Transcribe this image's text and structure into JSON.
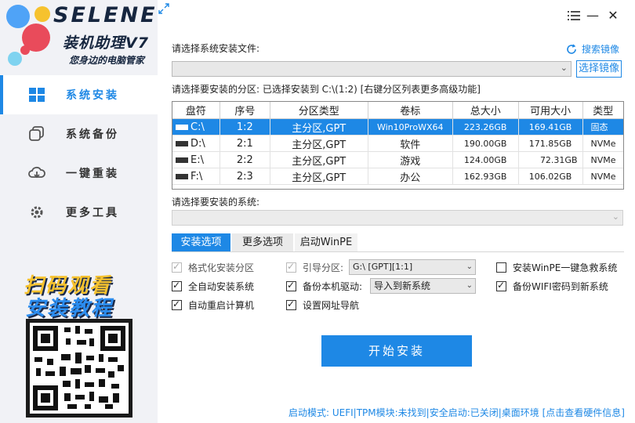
{
  "brand": {
    "name": "SELENE",
    "product": "装机助理V7",
    "tagline": "您身边的电脑管家"
  },
  "sidebar": {
    "items": [
      {
        "label": "系统安装",
        "icon": "windows-icon",
        "active": true
      },
      {
        "label": "系统备份",
        "icon": "copy-icon",
        "active": false
      },
      {
        "label": "一键重装",
        "icon": "cloud-download-icon",
        "active": false
      },
      {
        "label": "更多工具",
        "icon": "gear-icon",
        "active": false
      }
    ],
    "promo_line1": "扫码观看",
    "promo_line2": "安装教程"
  },
  "window": {
    "menu_icon": "menu-icon",
    "minimize": "—",
    "close": "✕"
  },
  "file_section": {
    "label": "请选择系统安装文件:",
    "search_image": "搜索镜像",
    "file_value": "",
    "choose_button": "选择镜像"
  },
  "partition_section": {
    "label": "请选择要安装的分区: 已选择安装到 C:\\(1:2) [右键分区列表更多高级功能]",
    "columns": [
      "盘符",
      "序号",
      "分区类型",
      "卷标",
      "总大小",
      "可用大小",
      "类型"
    ],
    "rows": [
      {
        "drive": "C:\\",
        "index": "1:2",
        "ptype": "主分区,GPT",
        "volume": "Win10ProWX64",
        "total": "223.26GB",
        "free": "169.41GB",
        "kind": "固态",
        "selected": true
      },
      {
        "drive": "D:\\",
        "index": "2:1",
        "ptype": "主分区,GPT",
        "volume": "软件",
        "total": "190.00GB",
        "free": "171.85GB",
        "kind": "NVMe",
        "selected": false
      },
      {
        "drive": "E:\\",
        "index": "2:2",
        "ptype": "主分区,GPT",
        "volume": "游戏",
        "total": "124.00GB",
        "free": "72.31GB",
        "kind": "NVMe",
        "selected": false
      },
      {
        "drive": "F:\\",
        "index": "2:3",
        "ptype": "主分区,GPT",
        "volume": "办公",
        "total": "162.93GB",
        "free": "106.02GB",
        "kind": "NVMe",
        "selected": false
      }
    ]
  },
  "system_section": {
    "label": "请选择要安装的系统:",
    "value": ""
  },
  "tabs": [
    {
      "label": "安装选项",
      "active": true
    },
    {
      "label": "更多选项",
      "active": false
    },
    {
      "label": "启动WinPE",
      "active": false
    }
  ],
  "options": {
    "format": "格式化安装分区",
    "boot_partition": "引导分区:",
    "boot_value": "G:\\ [GPT][1:1]",
    "winpe_rescue": "安装WinPE一键急救系统",
    "auto_install": "全自动安装系统",
    "backup_driver": "备份本机驱动:",
    "driver_value": "导入到新系统",
    "backup_wifi": "备份WIFI密码到新系统",
    "auto_restart": "自动重启计算机",
    "set_nav": "设置网址导航"
  },
  "start_button": "开始安装",
  "status_bar": "启动模式: UEFI|TPM模块:未找到|安全启动:已关闭|桌面环境 [点击查看硬件信息]",
  "colors": {
    "accent": "#1e88e5",
    "sidebar_bg": "#f1f2f6",
    "promo_yellow": "#f6c22e"
  }
}
